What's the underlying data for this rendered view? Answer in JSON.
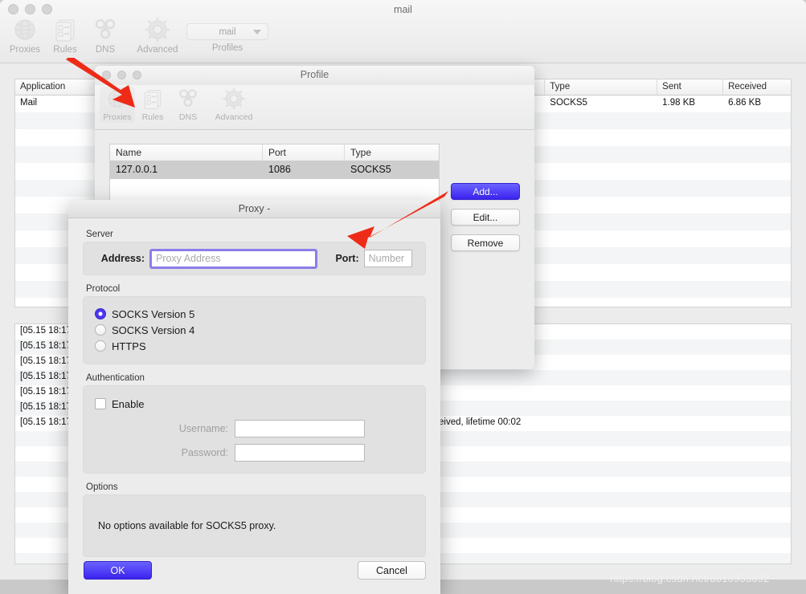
{
  "main_window": {
    "title": "mail",
    "toolbar": {
      "tabs": [
        {
          "label": "Proxies",
          "icon": "globe-icon"
        },
        {
          "label": "Rules",
          "icon": "list-document-icon"
        },
        {
          "label": "DNS",
          "icon": "dns-nodes-icon"
        },
        {
          "label": "Advanced",
          "icon": "gear-icon"
        }
      ],
      "profiles_caption": "Profiles",
      "profiles_selected": "mail"
    },
    "apps_table": {
      "columns": [
        "Application",
        "Type",
        "Sent",
        "Received"
      ],
      "rows": [
        {
          "application": "Mail",
          "type": "SOCKS5",
          "sent": "1.98 KB",
          "received": "6.86 KB"
        }
      ]
    },
    "log": {
      "lines": [
        "[05.15 18:17",
        "[05.15 18:17",
        "[05.15 18:17",
        "[05.15 18:17",
        "[05.15 18:17",
        "[05.15 18:17",
        "[05.15 18:17"
      ],
      "tail_fragment": "eived, lifetime 00:02"
    }
  },
  "profile_window": {
    "title": "Profile",
    "tabs": [
      {
        "label": "Proxies",
        "icon": "globe-icon"
      },
      {
        "label": "Rules",
        "icon": "list-document-icon"
      },
      {
        "label": "DNS",
        "icon": "dns-nodes-icon"
      },
      {
        "label": "Advanced",
        "icon": "gear-icon"
      }
    ],
    "proxy_table": {
      "columns": [
        "Name",
        "Port",
        "Type"
      ],
      "rows": [
        {
          "name": "127.0.0.1",
          "port": "1086",
          "type": "SOCKS5"
        }
      ]
    },
    "buttons": {
      "add": "Add...",
      "edit": "Edit...",
      "remove": "Remove"
    }
  },
  "proxy_dialog": {
    "title": "Proxy -",
    "server": {
      "group_label": "Server",
      "address_label": "Address:",
      "address_value": "",
      "address_placeholder": "Proxy Address",
      "port_label": "Port:",
      "port_value": "",
      "port_placeholder": "Number"
    },
    "protocol": {
      "group_label": "Protocol",
      "options": [
        {
          "label": "SOCKS Version 5",
          "selected": true
        },
        {
          "label": "SOCKS Version 4",
          "selected": false
        },
        {
          "label": "HTTPS",
          "selected": false
        }
      ]
    },
    "authentication": {
      "group_label": "Authentication",
      "enable_label": "Enable",
      "enable_checked": false,
      "username_label": "Username:",
      "username_value": "",
      "password_label": "Password:",
      "password_value": ""
    },
    "options": {
      "group_label": "Options",
      "message": "No options available for SOCKS5 proxy."
    },
    "footer": {
      "ok": "OK",
      "cancel": "Cancel"
    }
  },
  "annotations": {
    "accent_purple": "#4b36f0",
    "focus_ring": "#8b7ee8",
    "arrow_color": "#ee2b17",
    "watermark": "https://blog.csdn.net/u010953692"
  }
}
